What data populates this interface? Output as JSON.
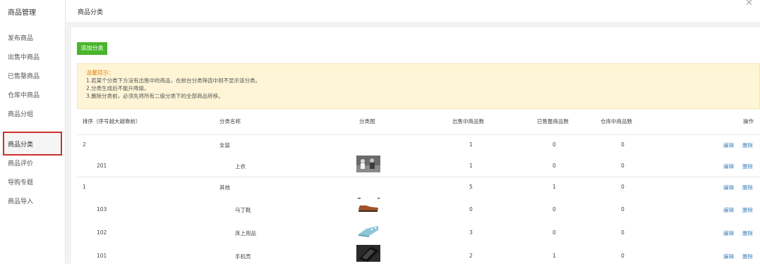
{
  "sidebar": {
    "title": "商品管理",
    "items": [
      {
        "label": "发布商品"
      },
      {
        "label": "出售中商品"
      },
      {
        "label": "已售罄商品"
      },
      {
        "label": "仓库中商品"
      },
      {
        "label": "商品分组"
      },
      {
        "label": "商品分类",
        "active": true
      },
      {
        "label": "商品评价"
      },
      {
        "label": "导购专题"
      },
      {
        "label": "商品导入"
      }
    ]
  },
  "header": {
    "title": "商品分类",
    "close_icon": "close-icon"
  },
  "add_button": "添加分类",
  "tips": {
    "title": "温馨提示：",
    "lines": [
      "1.若某个分类下方没有出售中的商品，在前台分类筛选中则不显示该分类。",
      "2.分类生成后不能升降级。",
      "3.删除分类前，必须先将所有二级分类下的全部商品转移。"
    ]
  },
  "table": {
    "headers": {
      "order": "排序（序号越大越靠前）",
      "name": "分类名称",
      "image": "分类图",
      "on_sale": "出售中商品数",
      "sold_out": "已售罄商品数",
      "warehouse": "仓库中商品数",
      "actions": "操作"
    },
    "edit_label": "编辑",
    "delete_label": "删除",
    "rows": [
      {
        "order": "2",
        "name": "女装",
        "on_sale": "1",
        "sold_out": "0",
        "warehouse": "0",
        "level": 1
      },
      {
        "order": "201",
        "name": "上衣",
        "on_sale": "1",
        "sold_out": "0",
        "warehouse": "0",
        "level": 2,
        "image": "photo-people"
      },
      {
        "order": "1",
        "name": "其他",
        "on_sale": "5",
        "sold_out": "1",
        "warehouse": "0",
        "level": 1
      },
      {
        "order": "103",
        "name": "马丁靴",
        "on_sale": "0",
        "sold_out": "0",
        "warehouse": "0",
        "level": 2,
        "image": "photo-boot"
      },
      {
        "order": "102",
        "name": "床上用品",
        "on_sale": "3",
        "sold_out": "0",
        "warehouse": "0",
        "level": 2,
        "image": "photo-bedding"
      },
      {
        "order": "101",
        "name": "手机壳",
        "on_sale": "2",
        "sold_out": "1",
        "warehouse": "0",
        "level": 2,
        "image": "photo-phonecase"
      }
    ]
  }
}
